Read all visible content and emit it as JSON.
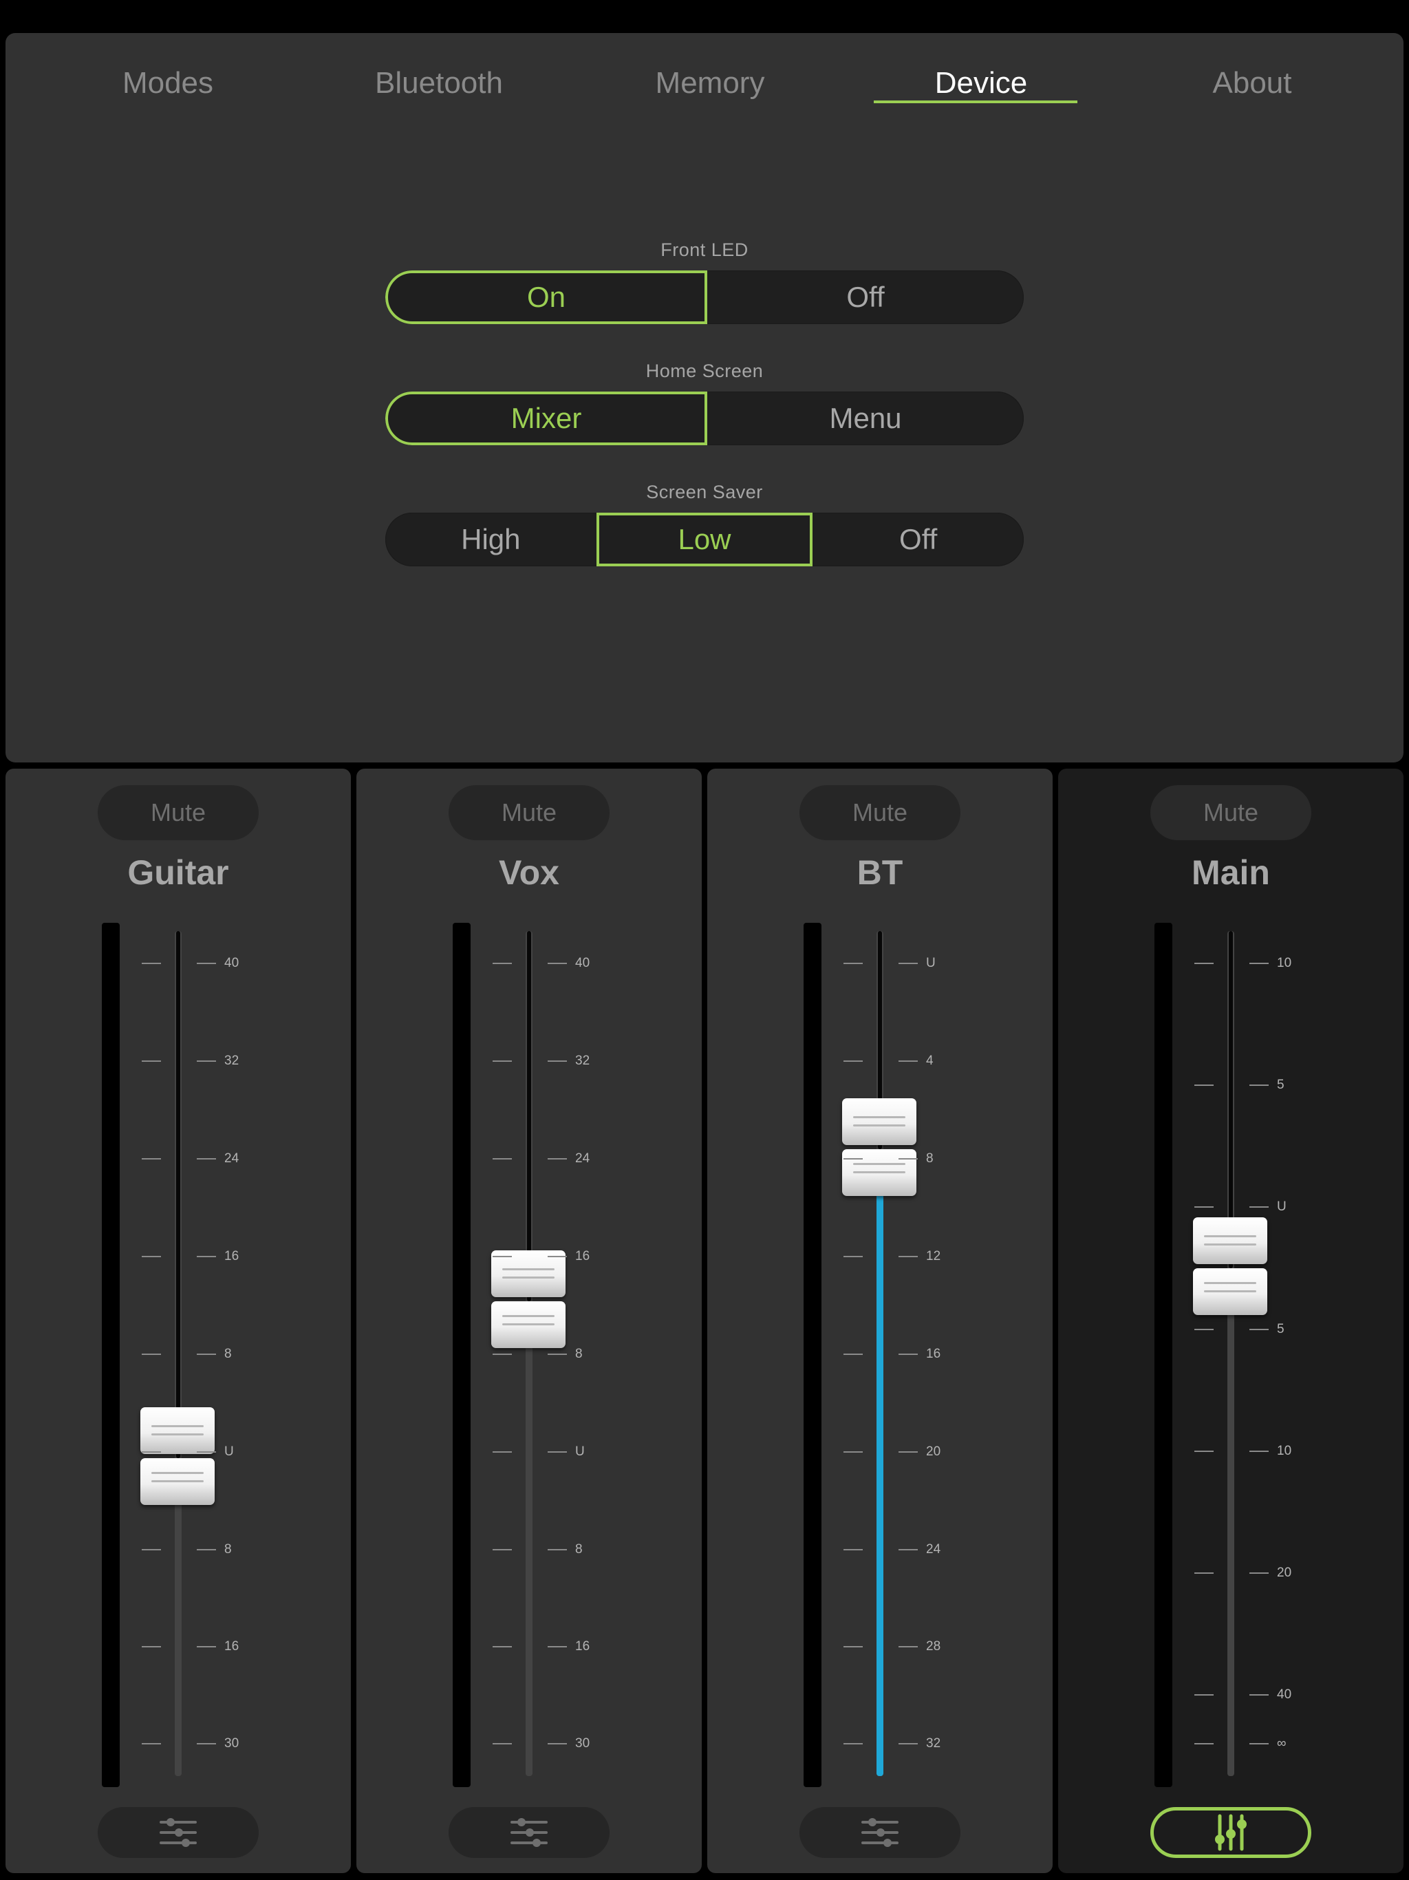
{
  "tabs": [
    {
      "label": "Modes",
      "active": false
    },
    {
      "label": "Bluetooth",
      "active": false
    },
    {
      "label": "Memory",
      "active": false
    },
    {
      "label": "Device",
      "active": true
    },
    {
      "label": "About",
      "active": false
    }
  ],
  "settings": {
    "front_led": {
      "label": "Front LED",
      "options": [
        "On",
        "Off"
      ],
      "selected": "On"
    },
    "home_screen": {
      "label": "Home Screen",
      "options": [
        "Mixer",
        "Menu"
      ],
      "selected": "Mixer"
    },
    "screen_saver": {
      "label": "Screen Saver",
      "options": [
        "High",
        "Low",
        "Off"
      ],
      "selected": "Low"
    }
  },
  "channels": [
    {
      "name": "Guitar",
      "mute_label": "Mute",
      "scale": [
        "40",
        "32",
        "24",
        "16",
        "8",
        "U",
        "8",
        "16",
        "30"
      ],
      "fader_level": 0.376,
      "active_fill": false
    },
    {
      "name": "Vox",
      "mute_label": "Mute",
      "scale": [
        "40",
        "32",
        "24",
        "16",
        "8",
        "U",
        "8",
        "16",
        "30"
      ],
      "fader_level": 0.562,
      "active_fill": false
    },
    {
      "name": "BT",
      "mute_label": "Mute",
      "scale": [
        "U",
        "4",
        "8",
        "12",
        "16",
        "20",
        "24",
        "28",
        "32"
      ],
      "fader_level": 0.742,
      "active_fill": true
    },
    {
      "name": "Main",
      "mute_label": "Mute",
      "scale": [
        "10",
        "5",
        "U",
        "5",
        "10",
        "20",
        "40",
        "∞"
      ],
      "fader_level": 0.601,
      "active_fill": false
    }
  ],
  "colors": {
    "accent": "#9bcf53",
    "fill": "#1fa8d8",
    "panel": "#323232"
  },
  "icons": {
    "eq_button": "sliders-icon",
    "mixer_button": "mixer-faders-icon"
  }
}
